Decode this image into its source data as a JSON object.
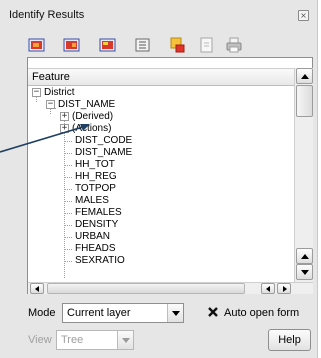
{
  "panel": {
    "title": "Identify Results",
    "close_glyph": "×"
  },
  "toolbar": {
    "icons": [
      "expand-tree-icon",
      "collapse-tree-icon",
      "expand-new-icon",
      "open-form-icon",
      "highlight-feature-icon",
      "copy-feature-icon",
      "print-icon"
    ]
  },
  "tree": {
    "header": "Feature",
    "items": [
      {
        "label": "District",
        "level": 0,
        "expander": "minus"
      },
      {
        "label": "DIST_NAME",
        "level": 1,
        "expander": "minus"
      },
      {
        "label": "(Derived)",
        "level": 2,
        "expander": "plus"
      },
      {
        "label": "(Actions)",
        "level": 2,
        "expander": "plus"
      },
      {
        "label": "DIST_CODE",
        "level": 2,
        "expander": "none"
      },
      {
        "label": "DIST_NAME",
        "level": 2,
        "expander": "none"
      },
      {
        "label": "HH_TOT",
        "level": 2,
        "expander": "none"
      },
      {
        "label": "HH_REG",
        "level": 2,
        "expander": "none"
      },
      {
        "label": "TOTPOP",
        "level": 2,
        "expander": "none"
      },
      {
        "label": "MALES",
        "level": 2,
        "expander": "none"
      },
      {
        "label": "FEMALES",
        "level": 2,
        "expander": "none"
      },
      {
        "label": "DENSITY",
        "level": 2,
        "expander": "none"
      },
      {
        "label": "URBAN",
        "level": 2,
        "expander": "none"
      },
      {
        "label": "FHEADS",
        "level": 2,
        "expander": "none"
      },
      {
        "label": "SEXRATIO",
        "level": 2,
        "expander": "none"
      }
    ]
  },
  "bottom": {
    "mode_label": "Mode",
    "mode_value": "Current layer",
    "auto_open_label": "Auto open form",
    "auto_open_checked": true,
    "view_label": "View",
    "view_value": "Tree",
    "help_label": "Help"
  },
  "colors": {
    "panel_bg": "#e6e6e6",
    "pointer_line": "#1f3f63"
  }
}
